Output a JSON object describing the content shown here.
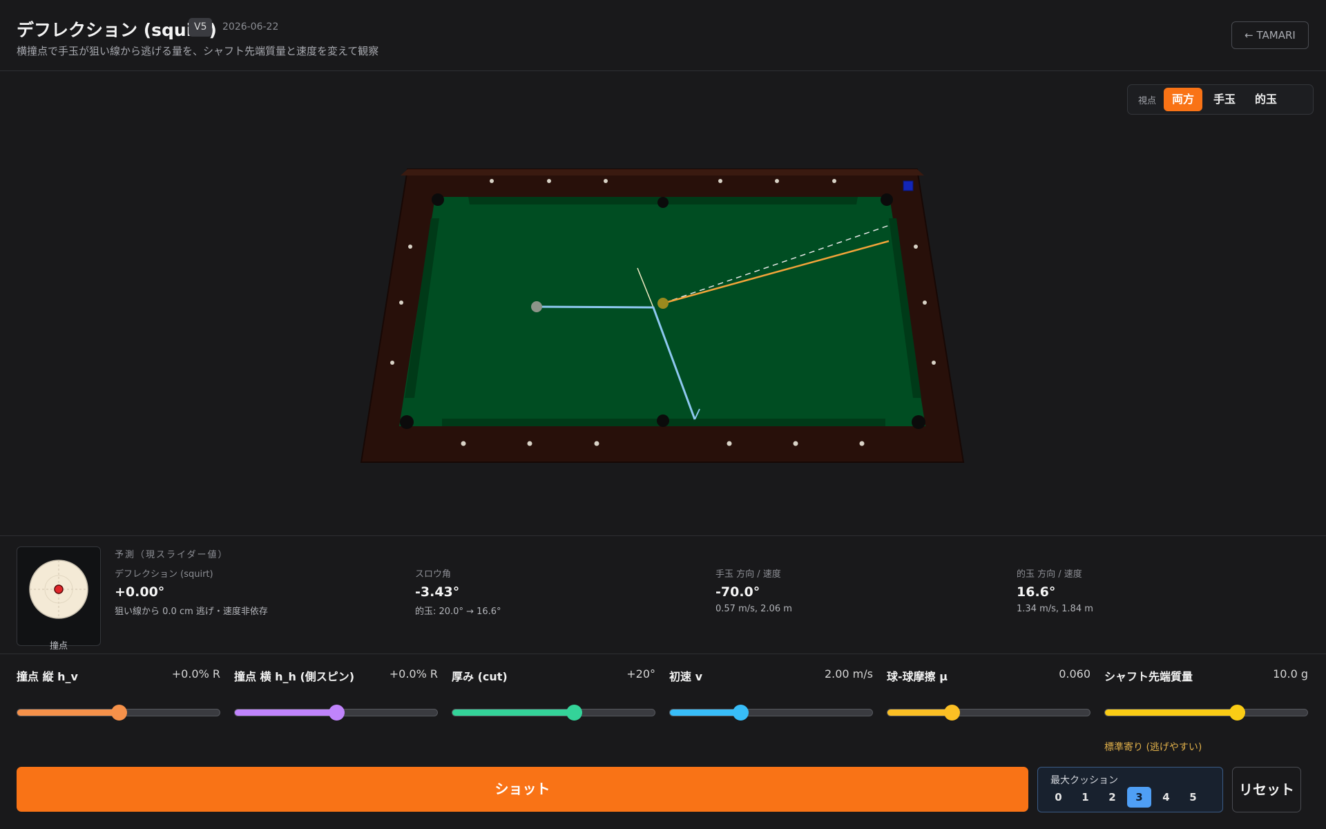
{
  "header": {
    "title": "デフレクション (squirt)",
    "version": "V5",
    "date": "2026-06-22",
    "subtitle": "横撞点で手玉が狙い線から逃げる量を、シャフト先端質量と速度を変えて観察",
    "back_label": "← TAMARI"
  },
  "viewpoint": {
    "label": "視点",
    "options": [
      "両方",
      "手玉",
      "的玉"
    ],
    "selected": "両方"
  },
  "hit_point": {
    "label": "撞点",
    "h_v": 0.0,
    "h_h": 0.0
  },
  "prediction": {
    "heading": "予測（現スライダー値）",
    "metrics": [
      {
        "label": "デフレクション (squirt)",
        "value": "+0.00°",
        "sub": "狙い線から 0.0 cm 逃げ・速度非依存"
      },
      {
        "label": "スロウ角",
        "value": "-3.43°",
        "sub": "的玉: 20.0° → 16.6°"
      },
      {
        "label": "手玉 方向 / 速度",
        "value": "-70.0°",
        "sub": "0.57 m/s, 2.06 m"
      },
      {
        "label": "的玉 方向 / 速度",
        "value": "16.6°",
        "sub": "1.34 m/s, 1.84 m"
      }
    ]
  },
  "sliders": [
    {
      "name": "撞点 縦 h_v",
      "value": "+0.0% R",
      "fraction": 0.5,
      "color": "#f5914a"
    },
    {
      "name": "撞点 横 h_h (側スピン)",
      "value": "+0.0% R",
      "fraction": 0.5,
      "color": "#c084fc"
    },
    {
      "name": "厚み (cut)",
      "value": "+20°",
      "fraction": 0.6,
      "color": "#34d399"
    },
    {
      "name": "初速 v",
      "value": "2.00 m/s",
      "fraction": 0.35,
      "color": "#38bdf8"
    },
    {
      "name": "球-球摩擦 μ",
      "value": "0.060",
      "fraction": 0.32,
      "color": "#fbbf24"
    },
    {
      "name": "シャフト先端質量",
      "value": "10.0 g",
      "fraction": 0.65,
      "color": "#facc15"
    }
  ],
  "shaft_note": "標準寄り (逃げやすい)",
  "shot_label": "ショット",
  "cushion": {
    "label": "最大クッション",
    "options": [
      "0",
      "1",
      "2",
      "3",
      "4",
      "5"
    ],
    "selected": "3"
  },
  "reset_label": "リセット",
  "colors": {
    "accent": "#f97316",
    "cue_path": "#8ec8f0",
    "object_path": "#f2a43a",
    "felt": "#004d22",
    "rail_wood": "#2a120c"
  }
}
